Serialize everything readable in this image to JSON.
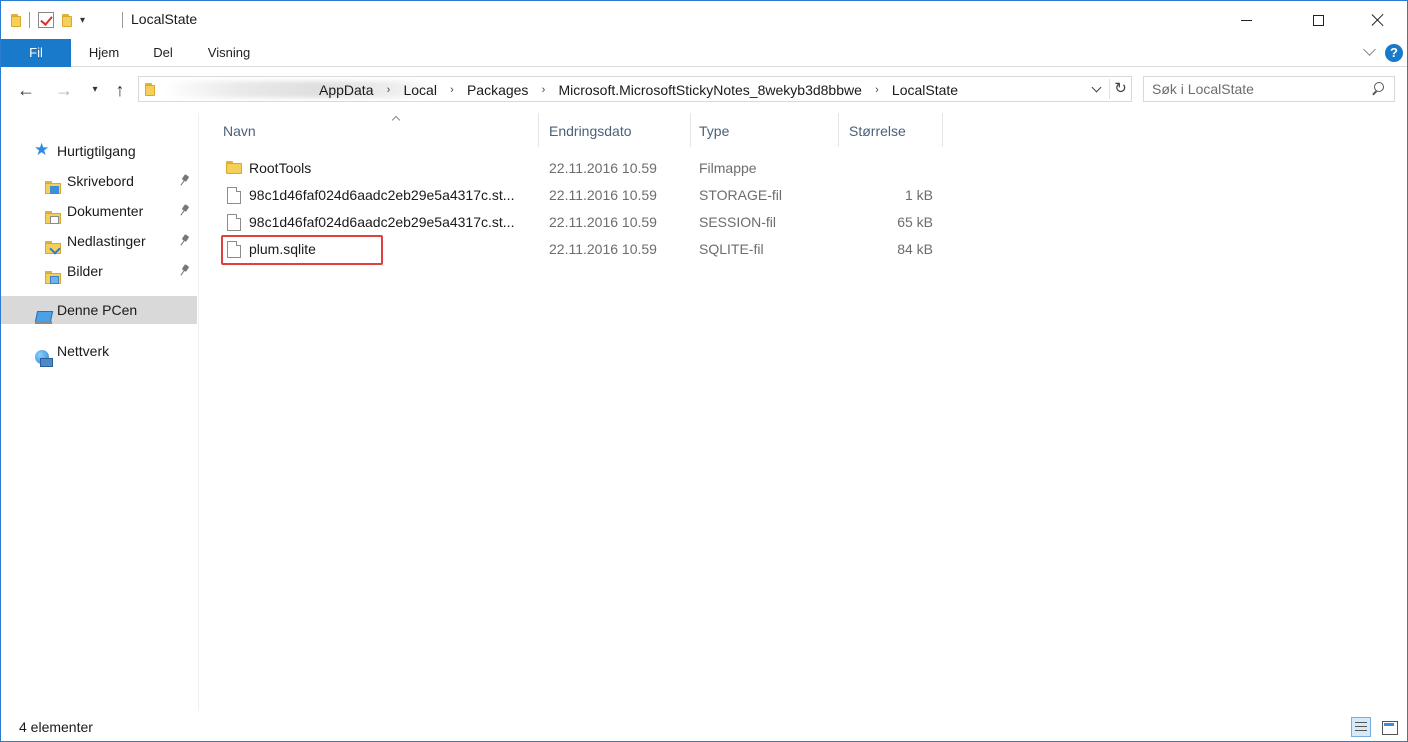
{
  "window": {
    "title": "LocalState",
    "quick_access_toolbar": [
      "folder-icon",
      "properties-check-icon",
      "new-folder-icon",
      "customize-dropdown-icon"
    ],
    "controls": [
      "minimize",
      "maximize",
      "close"
    ]
  },
  "ribbon": {
    "tabs": [
      {
        "label": "Fil",
        "active": true
      },
      {
        "label": "Hjem"
      },
      {
        "label": "Del"
      },
      {
        "label": "Visning"
      }
    ],
    "help_label": "?"
  },
  "address_bar": {
    "crumbs": [
      "AppData",
      "Local",
      "Packages",
      "Microsoft.MicrosoftStickyNotes_8wekyb3d8bbwe",
      "LocalState"
    ],
    "separator": "›",
    "refresh_glyph": "↻"
  },
  "search": {
    "placeholder": "Søk i LocalState"
  },
  "nav": {
    "back": "←",
    "forward": "→",
    "recent": "▾",
    "up": "↑"
  },
  "nav_pane": {
    "quick_access": {
      "label": "Hurtigtilgang",
      "icon": "star-icon"
    },
    "pinned": [
      {
        "label": "Skrivebord",
        "icon": "desktop-folder-icon",
        "pinned": true
      },
      {
        "label": "Dokumenter",
        "icon": "documents-folder-icon",
        "pinned": true
      },
      {
        "label": "Nedlastinger",
        "icon": "downloads-folder-icon",
        "pinned": true
      },
      {
        "label": "Bilder",
        "icon": "pictures-folder-icon",
        "pinned": true
      }
    ],
    "this_pc": {
      "label": "Denne PCen",
      "icon": "computer-icon",
      "selected": true
    },
    "network": {
      "label": "Nettverk",
      "icon": "network-icon"
    }
  },
  "file_list": {
    "columns": [
      "Navn",
      "Endringsdato",
      "Type",
      "Størrelse"
    ],
    "sorted_by": "Navn",
    "rows": [
      {
        "name": "RootTools",
        "date": "22.11.2016 10.59",
        "type": "Filmappe",
        "size": "",
        "icon": "folder-icon"
      },
      {
        "name": "98c1d46faf024d6aadc2eb29e5a4317c.st...",
        "date": "22.11.2016 10.59",
        "type": "STORAGE-fil",
        "size": "1 kB",
        "icon": "file-icon"
      },
      {
        "name": "98c1d46faf024d6aadc2eb29e5a4317c.st...",
        "date": "22.11.2016 10.59",
        "type": "SESSION-fil",
        "size": "65 kB",
        "icon": "file-icon"
      },
      {
        "name": "plum.sqlite",
        "date": "22.11.2016 10.59",
        "type": "SQLITE-fil",
        "size": "84 kB",
        "icon": "file-icon",
        "highlighted": true
      }
    ],
    "highlight_color": "#e04040"
  },
  "status_bar": {
    "item_count": "4 elementer",
    "views": [
      "details-view",
      "large-icons-view"
    ]
  },
  "colors": {
    "accent": "#1979ca",
    "selection": "#d9d9d9",
    "column_header_text": "#4c607a"
  }
}
